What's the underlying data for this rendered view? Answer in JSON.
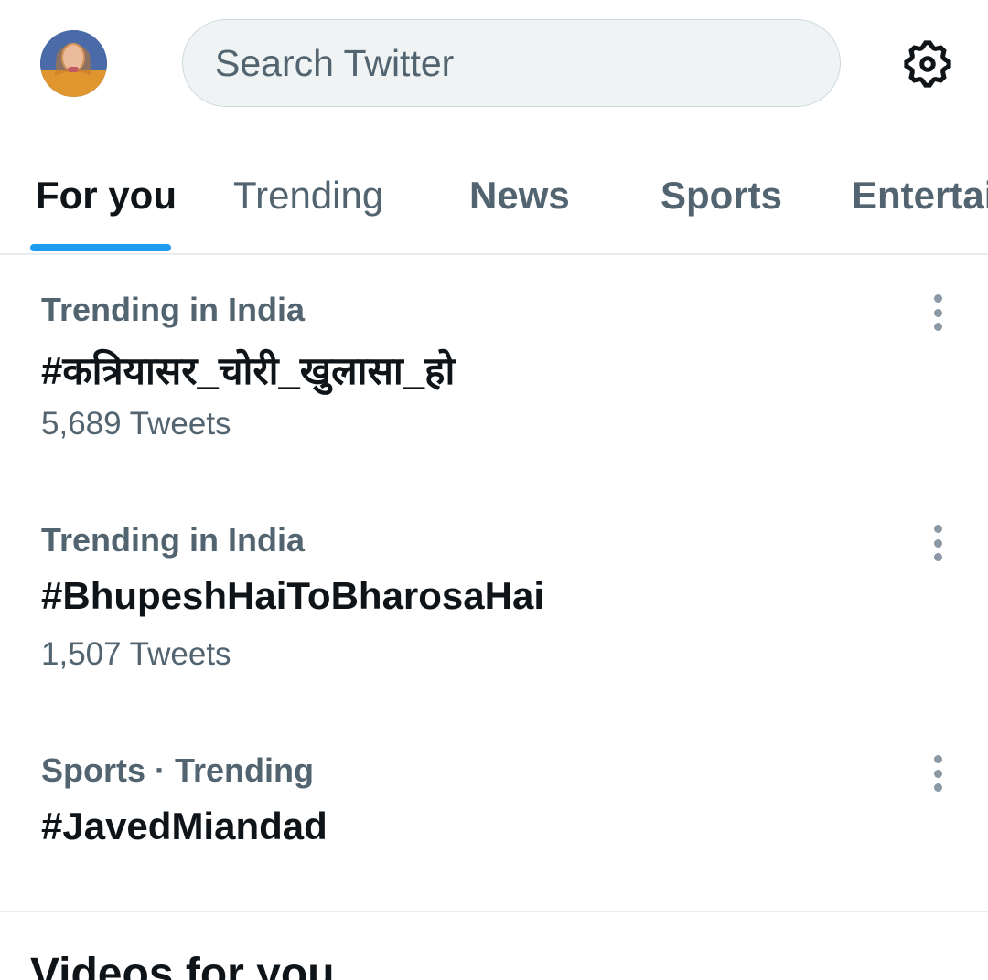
{
  "header": {
    "search_placeholder": "Search Twitter",
    "avatar_icon": "user-avatar",
    "settings_icon": "gear-icon"
  },
  "tabs": [
    {
      "label": "For you",
      "active": true
    },
    {
      "label": "Trending",
      "active": false
    },
    {
      "label": "News",
      "active": false
    },
    {
      "label": "Sports",
      "active": false
    },
    {
      "label": "Entertai",
      "active": false
    }
  ],
  "trends": [
    {
      "meta": "Trending in India",
      "title": "#कत्रियासर_चोरी_खुलासा_हो",
      "count": "5,689 Tweets"
    },
    {
      "meta": "Trending in India",
      "title": "#BhupeshHaiToBharosaHai",
      "count": "1,507 Tweets"
    },
    {
      "meta": "Sports · Trending",
      "title": "#JavedMiandad",
      "count": ""
    }
  ],
  "section": {
    "title": "Videos for you"
  },
  "colors": {
    "accent": "#1d9bf0",
    "secondary_text": "#536471",
    "primary_text": "#0f1419"
  }
}
